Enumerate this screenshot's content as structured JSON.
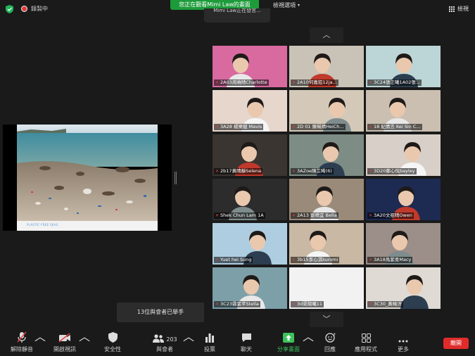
{
  "top": {
    "recording": "錄製中",
    "viewing_banner": "您正在觀看Mimi Law的畫面",
    "view_options": "檢視選項",
    "gallery_view": "檢視",
    "speaking": "Mimi Law正在發言..."
  },
  "shared_screen": {
    "caption": "PLASTIC FREE SEAS"
  },
  "participants": [
    {
      "name": "2A03周曉晴Charlotte",
      "bg": "#d86aa0"
    },
    {
      "name": "2A10何嘉鋁12ja...",
      "bg": "#c9c2b6"
    },
    {
      "name": "3C24張正曦1A02張...",
      "bg": "#bcd5d6"
    },
    {
      "name": "3A28 楊樂琨 Mavis",
      "bg": "#e6d6cc"
    },
    {
      "name": "2D 01 陳珮晴HeiCh...",
      "bg": "#d4c9b8"
    },
    {
      "name": "18 紀倩言 Kei Sin C...",
      "bg": "#cbbfb2"
    },
    {
      "name": "2b17黃晴靜Selena",
      "bg": "#3a3531"
    },
    {
      "name": "3AZoe陳芷晞(6)",
      "bg": "#7d8d86"
    },
    {
      "name": "3D20鄭心悅bayley",
      "bg": "#d8d0c8"
    },
    {
      "name": "Shek Chun Lam 1A",
      "bg": "#2c2c2c"
    },
    {
      "name": "2A13 劉晴宜 Bella",
      "bg": "#9a8a7a"
    },
    {
      "name": "3A20文祖晴Owen",
      "bg": "#1d2a52"
    },
    {
      "name": "Yuet hei Sung",
      "bg": "#aecde0"
    },
    {
      "name": "3b15李心淇kuromi",
      "bg": "#c8b8a4"
    },
    {
      "name": "3A18馬紫柔Macy",
      "bg": "#9c8e88"
    },
    {
      "name": "3C23霧紫芊Stella",
      "bg": "#7d9fa8"
    },
    {
      "name": "3d渠陽曦11",
      "bg": "#f2f2f2"
    },
    {
      "name": "3C30_黃曉汧",
      "bg": "#dfdad4"
    }
  ],
  "hands_raised": "13位與會者已舉手",
  "toolbar": {
    "unmute": "解除靜音",
    "start_video": "開啟視訊",
    "security": "安全性",
    "participants": "與會者",
    "participant_count": "203",
    "polls": "投票",
    "chat": "聊天",
    "share_screen": "分享畫面",
    "reactions": "回應",
    "apps": "應用程式",
    "more": "更多",
    "end": "離開"
  },
  "colors": {
    "share_green": "#3cc25b",
    "end_red": "#e02b2b",
    "banner_green": "#1d9b3a"
  }
}
